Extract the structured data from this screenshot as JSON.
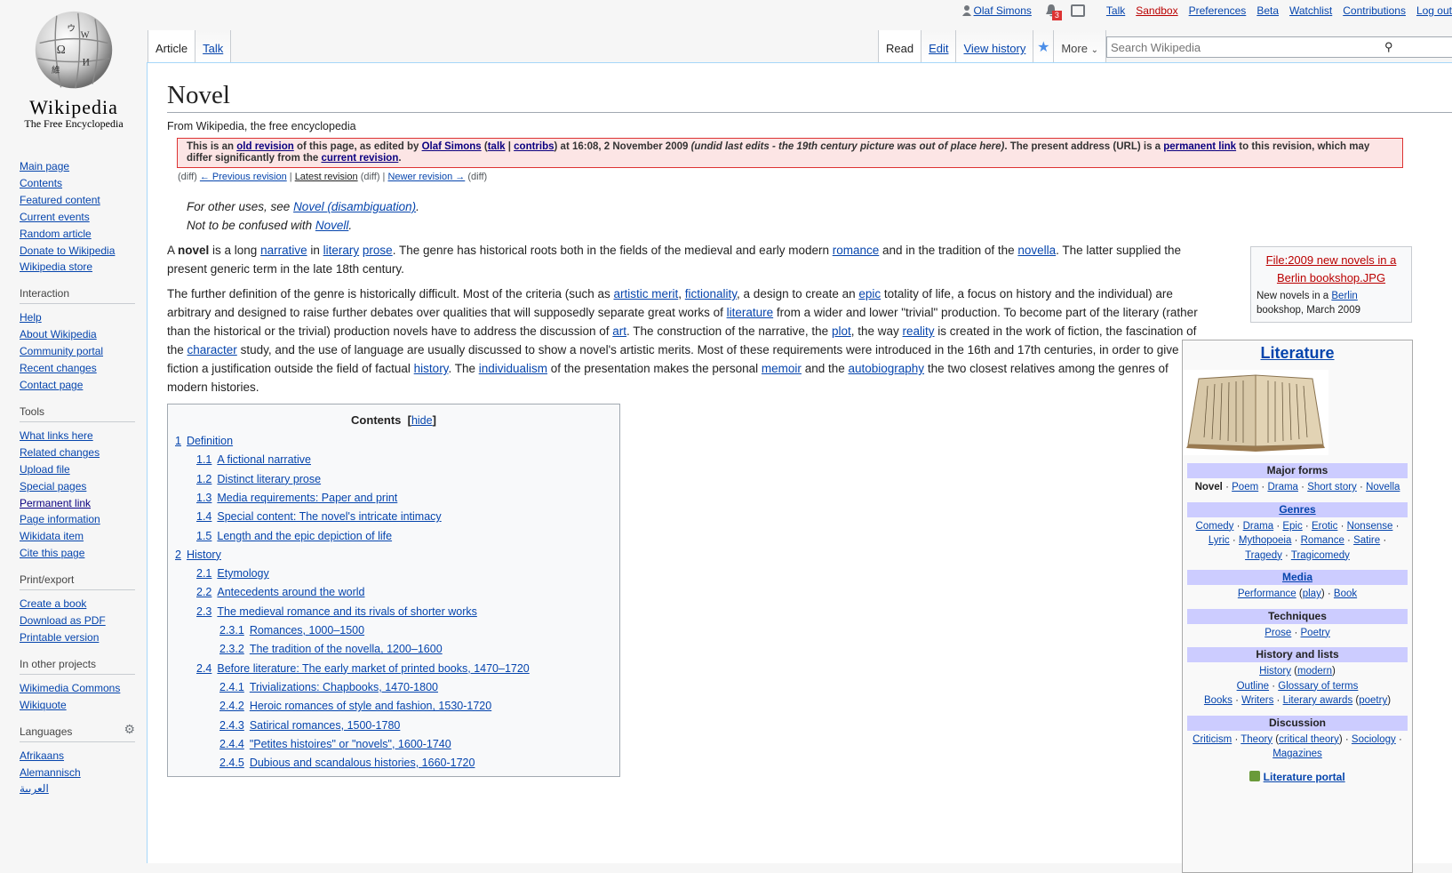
{
  "logo": {
    "wordmark": "Wikipedia",
    "tagline": "The Free Encyclopedia"
  },
  "personal": {
    "username": "Olaf Simons",
    "notification_count": "3",
    "links": [
      "Talk",
      "Sandbox",
      "Preferences",
      "Beta",
      "Watchlist",
      "Contributions",
      "Log out"
    ]
  },
  "tabs": {
    "left": [
      "Article",
      "Talk"
    ],
    "read": "Read",
    "edit": "Edit",
    "history": "View history",
    "more": "More"
  },
  "search": {
    "placeholder": "Search Wikipedia"
  },
  "sidebar": {
    "main": [
      "Main page",
      "Contents",
      "Featured content",
      "Current events",
      "Random article",
      "Donate to Wikipedia",
      "Wikipedia store"
    ],
    "interaction_title": "Interaction",
    "interaction": [
      "Help",
      "About Wikipedia",
      "Community portal",
      "Recent changes",
      "Contact page"
    ],
    "tools_title": "Tools",
    "tools": [
      "What links here",
      "Related changes",
      "Upload file",
      "Special pages",
      "Permanent link",
      "Page information",
      "Wikidata item",
      "Cite this page"
    ],
    "print_title": "Print/export",
    "print": [
      "Create a book",
      "Download as PDF",
      "Printable version"
    ],
    "projects_title": "In other projects",
    "projects": [
      "Wikimedia Commons",
      "Wikiquote"
    ],
    "languages_title": "Languages",
    "languages": [
      "Afrikaans",
      "Alemannisch",
      "العربية"
    ]
  },
  "article": {
    "title": "Novel",
    "sitesub": "From Wikipedia, the free encyclopedia",
    "revision": {
      "t1": "This is an ",
      "old_revision": "old revision",
      "t2": " of this page, as edited by ",
      "editor": "Olaf Simons",
      "t3": " (",
      "talk": "talk",
      "sep": " | ",
      "contribs": "contribs",
      "t4": ") at 16:08, 2 November 2009 ",
      "summary": "(undid last edits - the 19th century picture was out of place here)",
      "t5": ". The present address (URL) is a ",
      "permalink": "permanent link",
      "t6": " to this revision, which may differ significantly from the ",
      "current": "current revision",
      "t7": "."
    },
    "revnav": {
      "diff": "(diff)",
      "prev": "← Previous revision",
      "sep": " | ",
      "latest": "Latest revision",
      "diff2": "(diff)",
      "sep2": " | ",
      "newer": "Newer revision →",
      "diff3": "(diff)"
    },
    "hatnote1": {
      "t": "For other uses, see ",
      "link": "Novel (disambiguation)",
      "end": "."
    },
    "hatnote2": {
      "t": "Not to be confused with ",
      "link": "Novell",
      "end": "."
    },
    "p1": {
      "a": "A ",
      "bold": "novel",
      "b": " is a long ",
      "l1": "narrative",
      "c": " in ",
      "l2": "literary",
      "d": " ",
      "l3": "prose",
      "e": ". The genre has historical roots both in the fields of the medieval and early modern ",
      "l4": "romance",
      "f": " and in the tradition of the ",
      "l5": "novella",
      "g": ". The latter supplied the present generic term in the late 18th century."
    },
    "p2": {
      "a": "The further definition of the genre is historically difficult. Most of the criteria (such as ",
      "l1": "artistic merit",
      "b": ", ",
      "l2": "fictionality",
      "c": ", a design to create an ",
      "l3": "epic",
      "d": " totality of life, a focus on history and the individual) are arbitrary and designed to raise further debates over qualities that will supposedly separate great works of ",
      "l4": "literature",
      "e": " from a wider and lower \"trivial\" production. To become part of the literary (rather than the historical or the trivial) production novels have to address the discussion of ",
      "l5": "art",
      "f": ". The construction of the narrative, the ",
      "l6": "plot",
      "g": ", the way ",
      "l7": "reality",
      "h": " is created in the work of fiction, the fascination of the ",
      "l8": "character",
      "i": " study, and the use of language are usually discussed to show a novel's artistic merits. Most of these requirements were introduced in the 16th and 17th centuries, in order to give fiction a justification outside the field of factual ",
      "l9": "history",
      "j": ". The ",
      "l10": "individualism",
      "k": " of the presentation makes the personal ",
      "l11": "memoir",
      "l": " and the ",
      "l12": "autobiography",
      "m": " the two closest relatives among the genres of modern histories."
    }
  },
  "toc": {
    "title": "Contents",
    "hide": "hide",
    "items": [
      {
        "num": "1",
        "text": "Definition",
        "level": 1
      },
      {
        "num": "1.1",
        "text": "A fictional narrative",
        "level": 2
      },
      {
        "num": "1.2",
        "text": "Distinct literary prose",
        "level": 2
      },
      {
        "num": "1.3",
        "text": "Media requirements: Paper and print",
        "level": 2
      },
      {
        "num": "1.4",
        "text": "Special content: The novel's intricate intimacy",
        "level": 2
      },
      {
        "num": "1.5",
        "text": "Length and the epic depiction of life",
        "level": 2
      },
      {
        "num": "2",
        "text": "History",
        "level": 1
      },
      {
        "num": "2.1",
        "text": "Etymology",
        "level": 2
      },
      {
        "num": "2.2",
        "text": "Antecedents around the world",
        "level": 2
      },
      {
        "num": "2.3",
        "text": "The medieval romance and its rivals of shorter works",
        "level": 2
      },
      {
        "num": "2.3.1",
        "text": "Romances, 1000–1500",
        "level": 3
      },
      {
        "num": "2.3.2",
        "text": "The tradition of the novella, 1200–1600",
        "level": 3
      },
      {
        "num": "2.4",
        "text": "Before literature: The early market of printed books, 1470–1720",
        "level": 2
      },
      {
        "num": "2.4.1",
        "text": "Trivializations: Chapbooks, 1470-1800",
        "level": 3
      },
      {
        "num": "2.4.2",
        "text": "Heroic romances of style and fashion, 1530-1720",
        "level": 3
      },
      {
        "num": "2.4.3",
        "text": "Satirical romances, 1500-1780",
        "level": 3
      },
      {
        "num": "2.4.4",
        "text": "\"Petites histoires\" or \"novels\", 1600-1740",
        "level": 3
      },
      {
        "num": "2.4.5",
        "text": "Dubious and scandalous histories, 1660-1720",
        "level": 3
      }
    ]
  },
  "thumb": {
    "file_line1": "File:2009 new novels in a",
    "file_line2": "Berlin bookshop.JPG",
    "cap1": "New novels in a ",
    "cap_link": "Berlin",
    "cap2": "bookshop, March 2009"
  },
  "navbox": {
    "title": "Literature",
    "major_forms_head": "Major forms",
    "major_forms_current": "Novel",
    "major_forms": [
      "Poem",
      "Drama",
      "Short story",
      "Novella"
    ],
    "genres_head": "Genres",
    "genres_line1": [
      "Comedy",
      "Drama",
      "Epic",
      "Erotic",
      "Nonsense"
    ],
    "genres_line2": [
      "Lyric",
      "Mythopoeia",
      "Romance",
      "Satire"
    ],
    "genres_line3": [
      "Tragedy",
      "Tragicomedy"
    ],
    "media_head": "Media",
    "media": {
      "performance": "Performance",
      "play": "play",
      "book": "Book"
    },
    "techniques_head": "Techniques",
    "techniques": [
      "Prose",
      "Poetry"
    ],
    "history_head": "History and lists",
    "history": {
      "history": "History",
      "modern": "modern",
      "outline": "Outline",
      "glossary": "Glossary of terms",
      "books": "Books",
      "writers": "Writers",
      "awards": "Literary awards",
      "poetry": "poetry"
    },
    "discussion_head": "Discussion",
    "discussion": {
      "criticism": "Criticism",
      "theory": "Theory",
      "critical": "critical theory",
      "sociology": "Sociology",
      "magazines": "Magazines"
    },
    "portal": "Literature portal"
  }
}
